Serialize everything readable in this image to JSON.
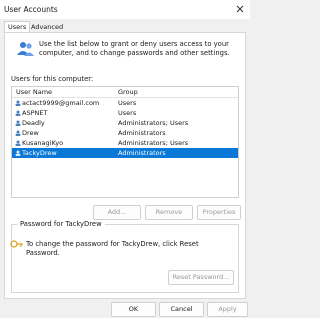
{
  "window": {
    "title": "User Accounts"
  },
  "tabs": [
    {
      "label": "Users",
      "active": true
    },
    {
      "label": "Advanced",
      "active": false
    }
  ],
  "intro": {
    "text": "Use the list below to grant or deny users access to your computer, and to change passwords and other settings."
  },
  "users_section": {
    "label": "Users for this computer:",
    "columns": {
      "name": "User Name",
      "group": "Group"
    },
    "rows": [
      {
        "name": "actact9999@gmail.com",
        "group": "Users"
      },
      {
        "name": "ASPNET",
        "group": "Users"
      },
      {
        "name": "Deadly",
        "group": "Administrators; Users"
      },
      {
        "name": "Drew",
        "group": "Administrators"
      },
      {
        "name": "KusanagiKyo",
        "group": "Administrators; Users"
      },
      {
        "name": "TackyDrew",
        "group": "Administrators"
      }
    ],
    "selected_row": 5
  },
  "list_buttons": {
    "add": "Add...",
    "remove": "Remove",
    "properties": "Properties"
  },
  "password_group": {
    "title": "Password for TackyDrew",
    "text": "To change the password for TackyDrew, click Reset Password.",
    "reset_button": "Reset Password..."
  },
  "dialog_buttons": {
    "ok": "OK",
    "cancel": "Cancel",
    "apply": "Apply"
  },
  "colors": {
    "selection": "#0a78d7",
    "panel_bg": "#ffffff",
    "window_bg": "#f0f0f0"
  }
}
